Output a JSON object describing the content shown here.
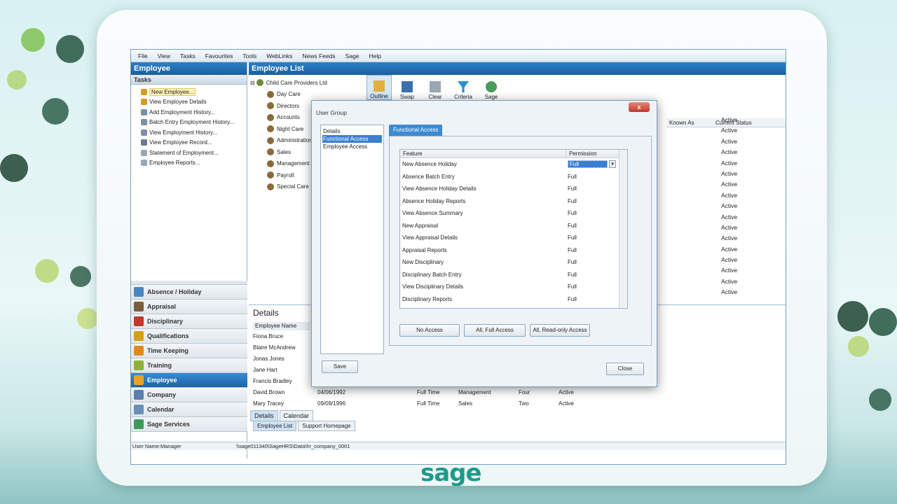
{
  "menu": [
    "File",
    "View",
    "Tasks",
    "Favourites",
    "Tools",
    "WebLinks",
    "News Feeds",
    "Sage",
    "Help"
  ],
  "left_panel": {
    "title": "Employee",
    "tasks_title": "Tasks",
    "tasks": [
      "New Employee...",
      "View Employee Details",
      "Add Employment History...",
      "Batch Entry Employment History...",
      "View Employment History...",
      "View Employee Record...",
      "Statement of Employment...",
      "Employee Reports..."
    ],
    "modules": [
      {
        "label": "Absence / Holiday",
        "color": "#4a86c5"
      },
      {
        "label": "Appraisal",
        "color": "#7b5e3b"
      },
      {
        "label": "Disciplinary",
        "color": "#c0392b"
      },
      {
        "label": "Qualifications",
        "color": "#d4a017"
      },
      {
        "label": "Time Keeping",
        "color": "#e08a1e"
      },
      {
        "label": "Training",
        "color": "#8fb03a"
      },
      {
        "label": "Employee",
        "color": "#e6a42a"
      },
      {
        "label": "Company",
        "color": "#5a7fa8"
      },
      {
        "label": "Calendar",
        "color": "#6a8fb8"
      },
      {
        "label": "Sage Services",
        "color": "#3f9a5a"
      }
    ]
  },
  "status_bar": {
    "user": "User Name:Manager",
    "path": "\\\\sage011340\\SageHRS\\Data\\hr_company_0001"
  },
  "main": {
    "title": "Employee List",
    "tree": [
      "Child Care Providers Ltd",
      "Day Care",
      "Directors",
      "Accounts",
      "Night Care",
      "Administration",
      "Sales",
      "Management",
      "Payroll",
      "Special Care"
    ],
    "toolbar": [
      "Outline",
      "Swap",
      "Clear",
      "Criteria",
      "Sage"
    ],
    "grid_headers": {
      "known_as": "Known As",
      "current_status": "Current Status"
    },
    "statuses": [
      "Active",
      "Active",
      "Active",
      "Active",
      "Active",
      "Active",
      "Active",
      "Active",
      "Active",
      "Active",
      "Active",
      "Active",
      "Active",
      "Active",
      "Active",
      "Active",
      "Active"
    ],
    "details_title": "Details",
    "details_header": "Employee Name",
    "employees": [
      "Fiona Bruce",
      "Blaire McAndrew",
      "Jonas Jones",
      "Jane Hart",
      "Francis Bradley",
      "David Brown",
      "Mary Tracey"
    ],
    "detail_rows": [
      {
        "date": "04/06/1992",
        "type": "Full Time",
        "dept": "Management",
        "team": "Four",
        "status": "Active"
      },
      {
        "date": "09/09/1996",
        "type": "Full Time",
        "dept": "Sales",
        "team": "Two",
        "status": "Active"
      }
    ],
    "detail_tabs": [
      "Details",
      "Calendar"
    ],
    "bottom_tabs": [
      "Employee List",
      "Support Homepage"
    ]
  },
  "dialog": {
    "title": "User Group",
    "close_glyph": "x",
    "nav": [
      "Details",
      "Functional Access",
      "Employee Access"
    ],
    "tab": "Functional Access",
    "col_feature": "Feature",
    "col_permission": "Permission",
    "rows": [
      {
        "feature": "New Absence Holiday",
        "permission": "Full"
      },
      {
        "feature": "Absence Batch Entry",
        "permission": "Full"
      },
      {
        "feature": "View Absence Holiday Details",
        "permission": "Full"
      },
      {
        "feature": "Absence Holiday Reports",
        "permission": "Full"
      },
      {
        "feature": "View Absence Summary",
        "permission": "Full"
      },
      {
        "feature": "New Appraisal",
        "permission": "Full"
      },
      {
        "feature": "View Appraisal Details",
        "permission": "Full"
      },
      {
        "feature": "Appraisal Reports",
        "permission": "Full"
      },
      {
        "feature": "New Disciplinary",
        "permission": "Full"
      },
      {
        "feature": "Disciplinary Batch Entry",
        "permission": "Full"
      },
      {
        "feature": "View Disciplinary Details",
        "permission": "Full"
      },
      {
        "feature": "Disciplinary Reports",
        "permission": "Full"
      }
    ],
    "buttons": {
      "no_access": "No Access",
      "all_full": "All, Full Access",
      "all_read": "All, Read-only Access",
      "save": "Save",
      "close": "Close"
    }
  },
  "logo": "sage"
}
